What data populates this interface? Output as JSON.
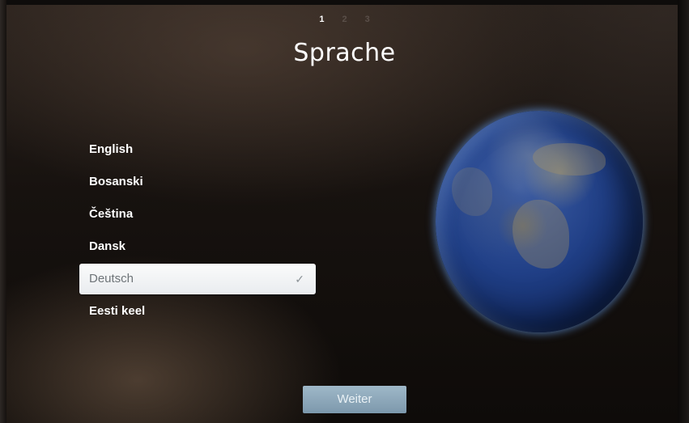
{
  "setup": {
    "steps": [
      "1",
      "2",
      "3"
    ],
    "active_step": 1
  },
  "title": "Sprache",
  "languages": [
    {
      "label": "English",
      "selected": false
    },
    {
      "label": "Bosanski",
      "selected": false
    },
    {
      "label": "Čeština",
      "selected": false
    },
    {
      "label": "Dansk",
      "selected": false
    },
    {
      "label": "Deutsch",
      "selected": true
    },
    {
      "label": "Eesti keel",
      "selected": false
    }
  ],
  "selected_check": "✓",
  "buttons": {
    "next_label": "Weiter"
  },
  "colors": {
    "selected_row_bg": "#f5f6f8",
    "next_button_bg": "#8eaabd",
    "globe_blue": "#203f86"
  }
}
